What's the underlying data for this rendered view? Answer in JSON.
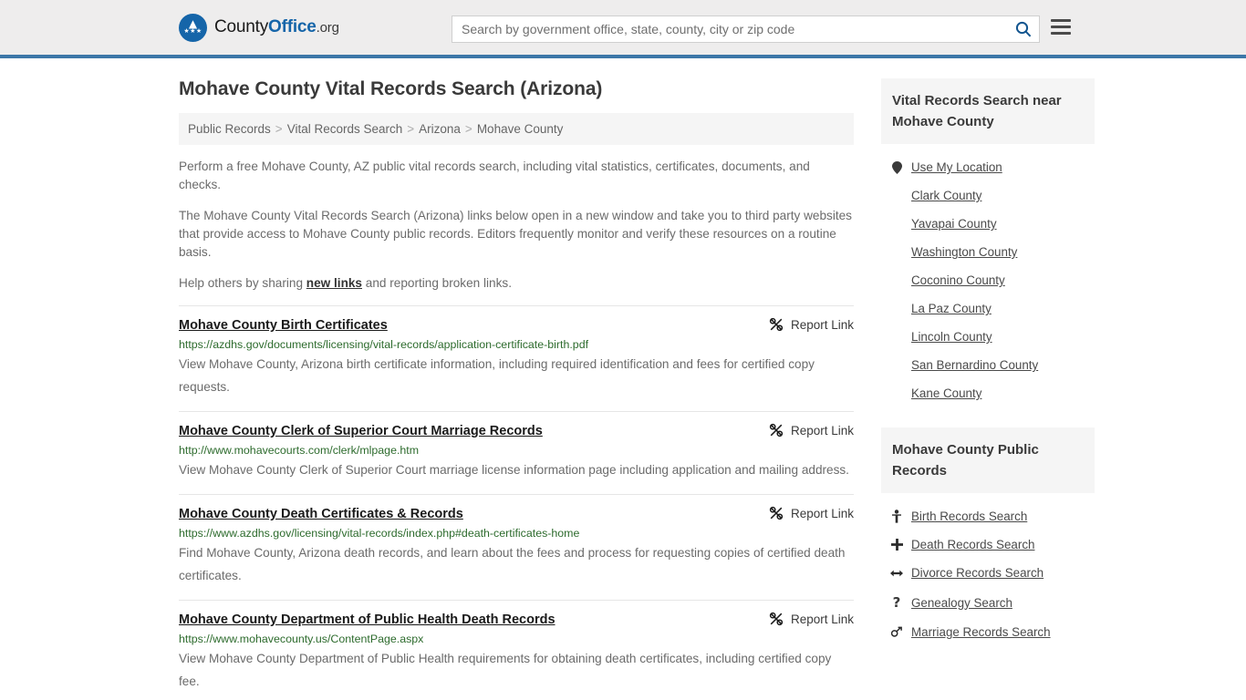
{
  "header": {
    "logo": {
      "part1": "County",
      "part2": "Office",
      "part3": ".org",
      "eagle_glyph": "▲",
      "stars_glyph": "★★★"
    },
    "search": {
      "placeholder": "Search by government office, state, county, city or zip code",
      "value": "",
      "icon": "search-icon"
    },
    "menu_icon": "hamburger-menu-icon",
    "accent_color": "#3d77a8"
  },
  "page": {
    "title": "Mohave County Vital Records Search (Arizona)",
    "breadcrumb": [
      {
        "label": "Public Records",
        "link": true
      },
      {
        "label": "Vital Records Search",
        "link": true
      },
      {
        "label": "Arizona",
        "link": true
      },
      {
        "label": "Mohave County",
        "link": false
      }
    ],
    "breadcrumb_separator": ">",
    "intro_1": "Perform a free Mohave County, AZ public vital records search, including vital statistics, certificates, documents, and checks.",
    "intro_2": "The Mohave County Vital Records Search (Arizona) links below open in a new window and take you to third party websites that provide access to Mohave County public records. Editors frequently monitor and verify these resources on a routine basis.",
    "intro_3_before": "Help others by sharing ",
    "intro_3_link": "new links",
    "intro_3_after": " and reporting broken links."
  },
  "results": {
    "report_label": "Report Link",
    "report_icon": "broken-link-icon",
    "items": [
      {
        "title": "Mohave County Birth Certificates",
        "url": "https://azdhs.gov/documents/licensing/vital-records/application-certificate-birth.pdf",
        "description": "View Mohave County, Arizona birth certificate information, including required identification and fees for certified copy requests."
      },
      {
        "title": "Mohave County Clerk of Superior Court Marriage Records",
        "url": "http://www.mohavecourts.com/clerk/mlpage.htm",
        "description": "View Mohave County Clerk of Superior Court marriage license information page including application and mailing address."
      },
      {
        "title": "Mohave County Death Certificates & Records",
        "url": "https://www.azdhs.gov/licensing/vital-records/index.php#death-certificates-home",
        "description": "Find Mohave County, Arizona death records, and learn about the fees and process for requesting copies of certified death certificates."
      },
      {
        "title": "Mohave County Department of Public Health Death Records",
        "url": "https://www.mohavecounty.us/ContentPage.aspx",
        "description": "View Mohave County Department of Public Health requirements for obtaining death certificates, including certified copy fee."
      }
    ]
  },
  "sidebar": {
    "nearby": {
      "heading": "Vital Records Search near Mohave County",
      "items": [
        {
          "label": "Use My Location",
          "icon": "map-pin-icon",
          "icon_glyph": "▾"
        },
        {
          "label": "Clark County",
          "icon": "",
          "icon_glyph": ""
        },
        {
          "label": "Yavapai County",
          "icon": "",
          "icon_glyph": ""
        },
        {
          "label": "Washington County",
          "icon": "",
          "icon_glyph": ""
        },
        {
          "label": "Coconino County",
          "icon": "",
          "icon_glyph": ""
        },
        {
          "label": "La Paz County",
          "icon": "",
          "icon_glyph": ""
        },
        {
          "label": "Lincoln County",
          "icon": "",
          "icon_glyph": ""
        },
        {
          "label": "San Bernardino County",
          "icon": "",
          "icon_glyph": ""
        },
        {
          "label": "Kane County",
          "icon": "",
          "icon_glyph": ""
        }
      ]
    },
    "public_records": {
      "heading": "Mohave County Public Records",
      "items": [
        {
          "label": "Birth Records Search",
          "icon": "baby-icon",
          "icon_glyph": "Ŧ"
        },
        {
          "label": "Death Records Search",
          "icon": "cross-icon",
          "icon_glyph": "✚"
        },
        {
          "label": "Divorce Records Search",
          "icon": "left-right-arrow-icon",
          "icon_glyph": "↔"
        },
        {
          "label": "Genealogy Search",
          "icon": "question-mark-icon",
          "icon_glyph": "?"
        },
        {
          "label": "Marriage Records Search",
          "icon": "gender-symbols-icon",
          "icon_glyph": "⚤"
        }
      ]
    }
  }
}
